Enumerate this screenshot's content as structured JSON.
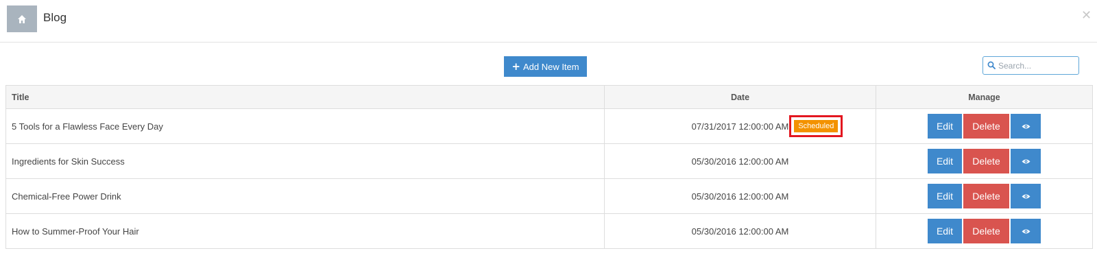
{
  "header": {
    "title": "Blog",
    "home_icon": "home-icon",
    "close_label": "✕"
  },
  "toolbar": {
    "add_label": "Add New Item",
    "add_icon": "plus-icon",
    "search_placeholder": "Search...",
    "search_value": ""
  },
  "table": {
    "columns": [
      "Title",
      "Date",
      "Manage"
    ],
    "rows": [
      {
        "title": "5 Tools for a Flawless Face Every Day",
        "date": "07/31/2017 12:00:00 AM",
        "badge": "Scheduled"
      },
      {
        "title": "Ingredients for Skin Success",
        "date": "05/30/2016 12:00:00 AM",
        "badge": ""
      },
      {
        "title": "Chemical-Free Power Drink",
        "date": "05/30/2016 12:00:00 AM",
        "badge": ""
      },
      {
        "title": "How to Summer-Proof Your Hair",
        "date": "05/30/2016 12:00:00 AM",
        "badge": ""
      }
    ],
    "actions": {
      "edit_label": "Edit",
      "delete_label": "Delete",
      "view_icon": "eye-icon"
    }
  },
  "colors": {
    "primary": "#3f89cc",
    "danger": "#d9544f",
    "warning": "#f39200",
    "highlight": "#e3161f",
    "home_bg": "#a9b4be"
  }
}
